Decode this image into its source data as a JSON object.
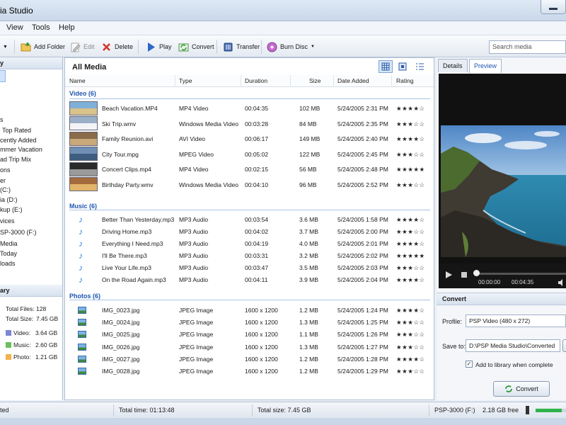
{
  "window": {
    "title": "ia Studio"
  },
  "menu": [
    "View",
    "Tools",
    "Help"
  ],
  "toolbar": {
    "add_folder": "Add Folder",
    "edit": "Edit",
    "delete": "Delete",
    "play": "Play",
    "convert": "Convert",
    "transfer": "Transfer",
    "burn_disc": "Burn Disc",
    "search_placeholder": "Search media"
  },
  "left_panel": {
    "header": "y",
    "items": [
      "s",
      "Top Rated",
      "cently Added",
      "mmer Vacation",
      "ad Trip Mix",
      "ons",
      "er",
      "(C:)",
      "ia (D:)",
      "kup (E:)",
      "vices",
      "SP-3000 (F:)",
      "Media",
      "Today",
      "loads"
    ],
    "library_header": "ary",
    "total_files_label": "Total Files:",
    "total_files": "128",
    "total_size_label": "Total Size:",
    "total_size": "7.45 GB",
    "breakdown": [
      {
        "label": "Video:",
        "value": "3.64 GB",
        "color": "#7b86d6"
      },
      {
        "label": "Music:",
        "value": "2.60 GB",
        "color": "#6bbf5e"
      },
      {
        "label": "Photo:",
        "value": "1.21 GB",
        "color": "#f3b14b"
      }
    ]
  },
  "main": {
    "title": "All Media",
    "columns": [
      "Name",
      "Type",
      "Duration",
      "Size",
      "Date Added",
      "Rating"
    ],
    "groups": [
      {
        "label": "Video (6)",
        "rows": [
          {
            "name": "Beach Vacation.MP4",
            "type": "MP4 Video",
            "duration": "00:04:35",
            "size": "102 MB",
            "date": "5/24/2005 2:31 PM",
            "rating": 4
          },
          {
            "name": "Ski Trip.wmv",
            "type": "Windows Media Video",
            "duration": "00:03:28",
            "size": "84 MB",
            "date": "5/24/2005 2:35 PM",
            "rating": 3
          },
          {
            "name": "Family Reunion.avi",
            "type": "AVI Video",
            "duration": "00:06:17",
            "size": "149 MB",
            "date": "5/24/2005 2:40 PM",
            "rating": 4
          },
          {
            "name": "City Tour.mpg",
            "type": "MPEG Video",
            "duration": "00:05:02",
            "size": "122 MB",
            "date": "5/24/2005 2:45 PM",
            "rating": 3
          },
          {
            "name": "Concert Clips.mp4",
            "type": "MP4 Video",
            "duration": "00:02:15",
            "size": "56 MB",
            "date": "5/24/2005 2:48 PM",
            "rating": 5
          },
          {
            "name": "Birthday Party.wmv",
            "type": "Windows Media Video",
            "duration": "00:04:10",
            "size": "96 MB",
            "date": "5/24/2005 2:52 PM",
            "rating": 3
          }
        ]
      },
      {
        "label": "Music (6)",
        "rows": [
          {
            "name": "Better Than Yesterday.mp3",
            "type": "MP3 Audio",
            "duration": "00:03:54",
            "size": "3.6 MB",
            "date": "5/24/2005 1:58 PM",
            "rating": 4
          },
          {
            "name": "Driving Home.mp3",
            "type": "MP3 Audio",
            "duration": "00:04:02",
            "size": "3.7 MB",
            "date": "5/24/2005 2:00 PM",
            "rating": 3
          },
          {
            "name": "Everything I Need.mp3",
            "type": "MP3 Audio",
            "duration": "00:04:19",
            "size": "4.0 MB",
            "date": "5/24/2005 2:01 PM",
            "rating": 4
          },
          {
            "name": "I'll Be There.mp3",
            "type": "MP3 Audio",
            "duration": "00:03:31",
            "size": "3.2 MB",
            "date": "5/24/2005 2:02 PM",
            "rating": 5
          },
          {
            "name": "Live Your Life.mp3",
            "type": "MP3 Audio",
            "duration": "00:03:47",
            "size": "3.5 MB",
            "date": "5/24/2005 2:03 PM",
            "rating": 3
          },
          {
            "name": "On the Road Again.mp3",
            "type": "MP3 Audio",
            "duration": "00:04:11",
            "size": "3.9 MB",
            "date": "5/24/2005 2:04 PM",
            "rating": 4
          }
        ]
      },
      {
        "label": "Photos (6)",
        "rows": [
          {
            "name": "IMG_0023.jpg",
            "type": "JPEG Image",
            "duration": "1600 x 1200",
            "size": "1.2 MB",
            "date": "5/24/2005 1:24 PM",
            "rating": 4
          },
          {
            "name": "IMG_0024.jpg",
            "type": "JPEG Image",
            "duration": "1600 x 1200",
            "size": "1.3 MB",
            "date": "5/24/2005 1:25 PM",
            "rating": 3
          },
          {
            "name": "IMG_0025.jpg",
            "type": "JPEG Image",
            "duration": "1600 x 1200",
            "size": "1.1 MB",
            "date": "5/24/2005 1:26 PM",
            "rating": 3
          },
          {
            "name": "IMG_0026.jpg",
            "type": "JPEG Image",
            "duration": "1600 x 1200",
            "size": "1.3 MB",
            "date": "5/24/2005 1:27 PM",
            "rating": 3
          },
          {
            "name": "IMG_0027.jpg",
            "type": "JPEG Image",
            "duration": "1600 x 1200",
            "size": "1.2 MB",
            "date": "5/24/2005 1:28 PM",
            "rating": 4
          },
          {
            "name": "IMG_0028.jpg",
            "type": "JPEG Image",
            "duration": "1600 x 1200",
            "size": "1.2 MB",
            "date": "5/24/2005 1:29 PM",
            "rating": 3
          }
        ]
      }
    ]
  },
  "right_panel": {
    "tabs": [
      "Details",
      "Preview"
    ],
    "active_tab": "Preview",
    "player": {
      "current_time": "00:00:00",
      "total_time": "00:04:35",
      "progress": 0.0
    },
    "convert_header": "Convert",
    "profile_label": "Profile:",
    "profile_value": "PSP Video (480 x 272)",
    "save_to_label": "Save to:",
    "save_to_value": "D:\\PSP Media Studio\\Converted",
    "add_to_library_label": "Add to library when complete",
    "add_to_library_checked": true,
    "convert_button": "Convert"
  },
  "status": {
    "left": "ted",
    "total_time": "Total time: 01:13:48",
    "total_size": "Total size: 7.45 GB",
    "device": "PSP-3000 (F:)",
    "free": "2.18 GB free",
    "device_used_fraction": 0.85
  },
  "colors": {
    "accent": "#1d55b0",
    "selection": "#cfe3fb",
    "device_bar": "#2fb34a"
  }
}
